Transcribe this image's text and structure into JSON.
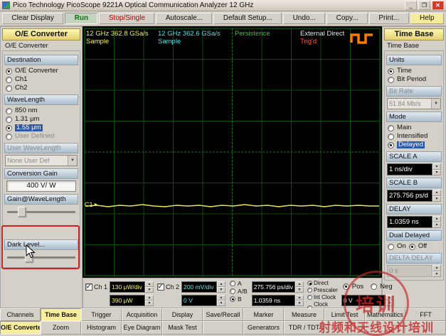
{
  "titlebar": {
    "title": "Pico Technology   PicoScope 9221A   Optical Communication Analyzer 12 GHz",
    "minimize": "_",
    "maximize": "❐",
    "close": "✕"
  },
  "toolbar": {
    "clear_display": "Clear Display",
    "run": "Run",
    "stop_single": "Stop/Single",
    "autoscale": "Autoscale...",
    "default_setup": "Default Setup...",
    "undo": "Undo...",
    "copy": "Copy...",
    "print": "Print...",
    "help": "Help"
  },
  "oe_panel": {
    "header": "O/E Converter",
    "group_label": "O/E Converter",
    "destination": {
      "label": "Destination",
      "options": [
        {
          "label": "O/E Converter",
          "selected": true
        },
        {
          "label": "Ch1",
          "selected": false
        },
        {
          "label": "Ch2",
          "selected": false
        }
      ]
    },
    "wavelength": {
      "label": "WaveLength",
      "options": [
        {
          "label": "850 nm",
          "selected": false
        },
        {
          "label": "1.31 μm",
          "selected": false
        },
        {
          "label": "1.55 μm",
          "selected": true
        },
        {
          "label": "User Defined",
          "selected": false,
          "disabled": true
        }
      ]
    },
    "user_wavelength": {
      "label": "User WaveLength",
      "value": "None User Def",
      "disabled": true
    },
    "conversion_gain": {
      "label": "Conversion Gain",
      "value": "400 V/ W"
    },
    "gain_at_wavelength": {
      "label": "Gain@WaveLength"
    },
    "dark_level": {
      "label": "Dark Level..."
    }
  },
  "scope": {
    "ch1_info": {
      "line1": "12 GHz  362.8 GSa/s",
      "line2": "Sample"
    },
    "ch2_info": {
      "line1": "12 GHz  362.6 GSa/s",
      "line2": "Sample"
    },
    "persistence": "Persistence",
    "trigger_source": "External Direct",
    "trigger_status": "Trig'd",
    "trace_label": "C1",
    "trace_marker": "►"
  },
  "timebase_panel": {
    "header": "Time Base",
    "group_label": "Time Base",
    "units": {
      "label": "Units",
      "options": [
        {
          "label": "Time",
          "selected": true
        },
        {
          "label": "Bit Period",
          "selected": false
        }
      ]
    },
    "bit_rate": {
      "label": "Bit Rate",
      "value": "51.84 Mb/s",
      "disabled": true
    },
    "mode": {
      "label": "Mode",
      "options": [
        {
          "label": "Main",
          "selected": false
        },
        {
          "label": "Intensified",
          "selected": false
        },
        {
          "label": "Delayed",
          "selected": true
        }
      ]
    },
    "scale_a": {
      "label": "SCALE A",
      "value": "1 ns/div"
    },
    "scale_b": {
      "label": "SCALE B",
      "value": "275.756 ps/d"
    },
    "delay": {
      "label": "DELAY",
      "value": "1.0359 ns"
    },
    "dual_delayed": {
      "label": "Dual Delayed",
      "options": [
        {
          "label": "On",
          "selected": false
        },
        {
          "label": "Off",
          "selected": true
        }
      ]
    },
    "delta_delay": {
      "label": "DELTA DELAY",
      "value": "0 s",
      "disabled": true
    }
  },
  "channel_bar": {
    "ch1": {
      "label": "Ch 1",
      "checked": true,
      "scale": "130 μW/div",
      "offset": "390 μW"
    },
    "ch2": {
      "label": "Ch 2",
      "checked": true,
      "scale": "200 mV/div",
      "offset": "0 V"
    },
    "timebase_select": {
      "options": [
        {
          "label": "A",
          "selected": false
        },
        {
          "label": "A/B",
          "selected": false
        },
        {
          "label": "B",
          "selected": true
        }
      ]
    },
    "scale_display": "275.756 ps/div",
    "delay_display": "1.0359 ns",
    "trigger_source": {
      "options": [
        {
          "label": "Direct",
          "selected": true
        },
        {
          "label": "Prescaler",
          "selected": false
        },
        {
          "label": "Int Clock",
          "selected": false
        },
        {
          "label": "Clock Rec",
          "selected": false
        }
      ]
    },
    "slope": {
      "options": [
        {
          "label": "Pos",
          "selected": true
        },
        {
          "label": "Neg",
          "selected": false
        }
      ]
    },
    "trigger_level": "0 V"
  },
  "menu": {
    "row1": [
      "Channels",
      "Time Base",
      "Trigger",
      "Acquisition",
      "Display",
      "Save/Recall",
      "Marker",
      "Measure",
      "Limit Test",
      "Mathematics",
      "FFT"
    ],
    "row1_active": "Time Base",
    "row2": [
      "O/E Converter",
      "Zoom",
      "Histogram",
      "Eye Diagram",
      "Mask Test",
      "",
      "Generators",
      "TDR / TDT",
      "",
      "",
      ""
    ],
    "row2_active": "O/E Converter"
  },
  "watermark": {
    "stamp_text": "培训",
    "text": "射频和天线设计培训"
  },
  "colors": {
    "header_yellow": "#f2e68a",
    "selection_blue": "#2e57a4",
    "ch1_yellow": "#f8f850",
    "ch2_cyan": "#57e7e7",
    "grid_green": "#0c4e0c",
    "trace_yellow": "#e6e64e",
    "trigger_red": "#ff5a4a",
    "persistence_green": "#2fca2f",
    "annotation_red": "#d42020",
    "watermark_red": "#c32828",
    "logo_orange": "#ff7a00"
  }
}
